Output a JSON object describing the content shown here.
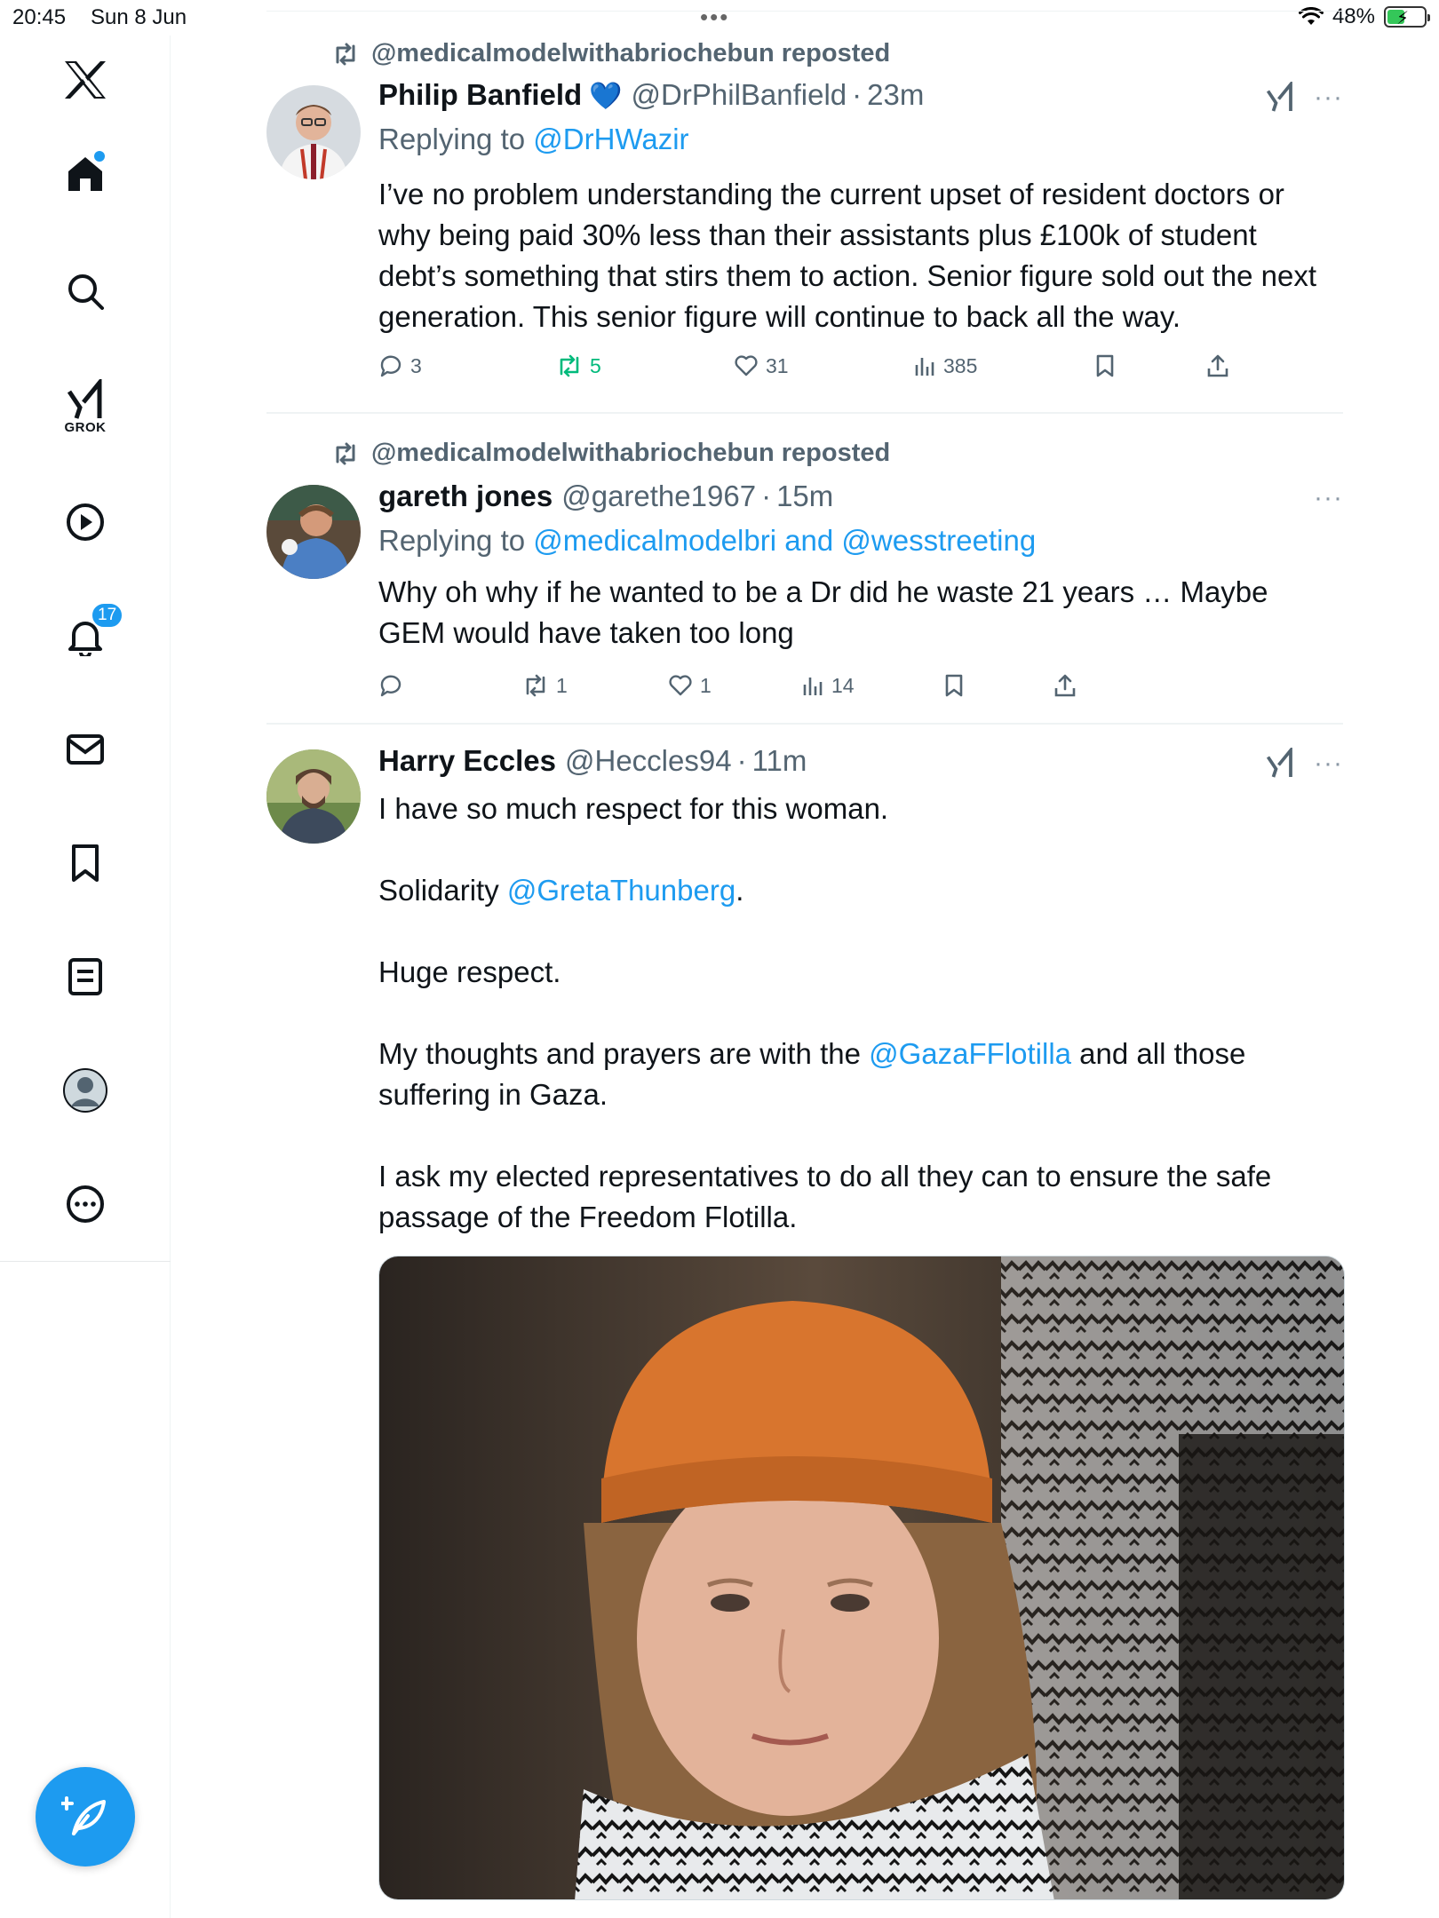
{
  "status_bar": {
    "time": "20:45",
    "date": "Sun 8 Jun",
    "battery": "48%",
    "battery_level": 0.48
  },
  "sidebar": {
    "grok_label": "GROK",
    "notification_count": "17",
    "items": [
      "x-logo",
      "home",
      "search",
      "grok",
      "video",
      "notifications",
      "messages",
      "bookmarks",
      "lists",
      "profile",
      "more"
    ]
  },
  "colors": {
    "accent": "#1d9bf0",
    "repost_green": "#00ba7c",
    "secondary": "#536471"
  },
  "posts": [
    {
      "repost_by": "@medicalmodelwithabriochebun reposted",
      "name": "Philip Banfield",
      "verified_emoji": "💙",
      "handle": "@DrPhilBanfield",
      "sep": "·",
      "time": "23m",
      "reply_prefix": "Replying to ",
      "reply_link": "@DrHWazir",
      "text": "I’ve no problem understanding the current upset of resident doctors or why being paid 30% less than their assistants plus £100k of student debt’s something that stirs them to action. Senior figure sold out the next generation. This senior figure will continue to back all the way.",
      "replies": "3",
      "reposts": "5",
      "likes": "31",
      "views": "385"
    },
    {
      "repost_by": "@medicalmodelwithabriochebun reposted",
      "name": "gareth jones",
      "handle": "@garethe1967",
      "sep": "·",
      "time": "15m",
      "reply_prefix": "Replying to ",
      "reply_link": "@medicalmodelbri and @wesstreeting",
      "text": "Why oh why if he wanted to be a Dr did he waste 21 years … Maybe GEM would have taken too long",
      "replies": "",
      "reposts": "1",
      "likes": "1",
      "views": "14"
    },
    {
      "name": "Harry Eccles",
      "handle": "@Heccles94",
      "sep": "·",
      "time": "11m",
      "line1": "I have so much respect for this woman.",
      "line2_prefix": "Solidarity ",
      "line2_link": "@GretaThunberg",
      "line2_suffix": ".",
      "line3": "Huge respect.",
      "line4_prefix": "My thoughts and prayers are with the ",
      "line4_link": "@GazaFFlotilla",
      "line4_suffix": " and all those suffering in Gaza.",
      "line5": "I ask my elected representatives to do all they can to ensure the safe passage of the Freedom Flotilla."
    }
  ]
}
